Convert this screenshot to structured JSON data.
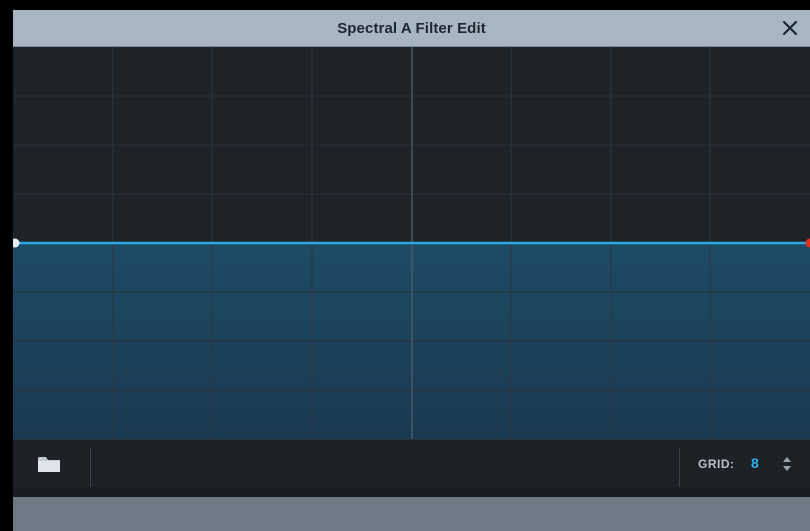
{
  "window": {
    "title": "Spectral A Filter Edit",
    "close_icon": "close-icon"
  },
  "editor": {
    "grid_divisions": 8,
    "curve_level": 0.5,
    "colors": {
      "background": "#1e2328",
      "curve": "#2ea8e4",
      "fill_top": "#1d4b66",
      "fill_bottom": "#1a3a51",
      "start_handle": "#e8edf2",
      "end_handle": "#e0301e"
    }
  },
  "bottombar": {
    "folder_icon": "folder-icon",
    "grid_label": "GRID:",
    "grid_value": "8",
    "stepper_icon": "up-down-arrows-icon"
  }
}
